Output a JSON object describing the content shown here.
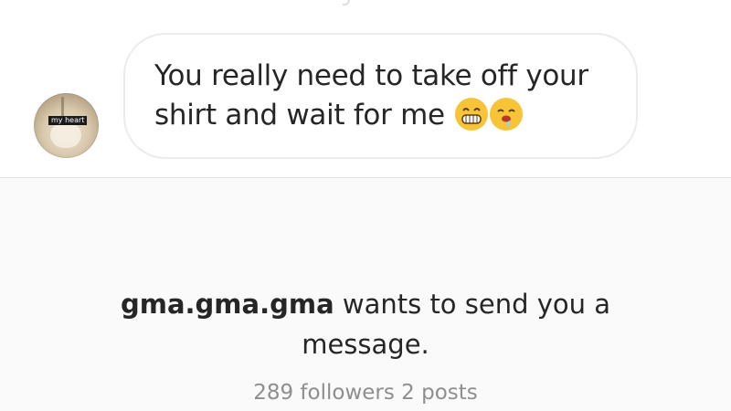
{
  "thread": {
    "avatar_label": "my heart",
    "message_text": "You really need to take off your shirt and wait for me",
    "emojis": [
      "grinning-face-icon",
      "drooling-face-icon"
    ],
    "emoji_color": "#f7c437",
    "bubble_border_color": "#ebebeb"
  },
  "request": {
    "username": "gma.gma.gma",
    "message_suffix": " wants to send you a message.",
    "followers": "289 followers",
    "posts": "2 posts",
    "background_color": "#fafafa",
    "meta_color": "#8e8e8e"
  }
}
